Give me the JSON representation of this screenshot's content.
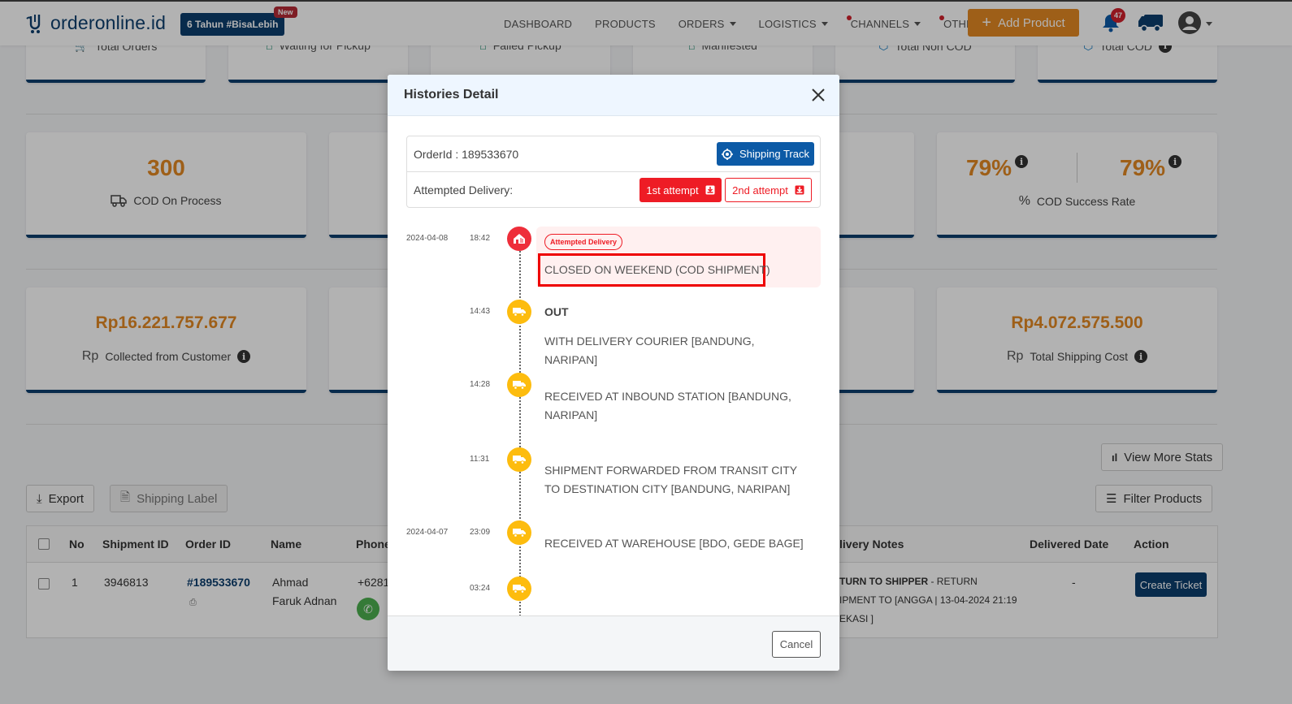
{
  "brand": {
    "name": "orderonline.id",
    "anniversary": "6 Tahun #BisaLebih",
    "new_badge": "New"
  },
  "nav": {
    "items": [
      {
        "label": "DASHBOARD",
        "dropdown": false,
        "dot": false
      },
      {
        "label": "PRODUCTS",
        "dropdown": false,
        "dot": false
      },
      {
        "label": "ORDERS",
        "dropdown": true,
        "dot": false
      },
      {
        "label": "LOGISTICS",
        "dropdown": true,
        "dot": false
      },
      {
        "label": "CHANNELS",
        "dropdown": true,
        "dot": true
      },
      {
        "label": "OTHERS",
        "dropdown": true,
        "dot": true
      }
    ],
    "add_product": "Add Product",
    "notification_count": "47"
  },
  "top_cards": [
    {
      "label": "Total Orders",
      "icon": "cart-icon"
    },
    {
      "label": "Waiting for Pickup",
      "icon": "warehouse-icon"
    },
    {
      "label": "Failed Pickup",
      "icon": "warehouse-icon"
    },
    {
      "label": "Manifested",
      "icon": "warehouse-icon"
    },
    {
      "label": "Total Non COD",
      "icon": "box-icon"
    },
    {
      "label": "Total COD",
      "icon": "box-icon"
    }
  ],
  "stats_row1": [
    {
      "value": "300",
      "label": "COD On Process",
      "icon": "truck-icon"
    },
    {
      "value": "",
      "label": ""
    },
    {
      "value": "",
      "label": ""
    },
    {
      "value_a": "79%",
      "value_b": "79%",
      "label": "COD Success Rate",
      "icon": "percent-icon"
    }
  ],
  "stats_row2": [
    {
      "value": "Rp16.221.757.677",
      "label": "Collected from Customer",
      "prefix": "Rp"
    },
    {
      "value": "",
      "label": ""
    },
    {
      "value": "",
      "label": ""
    },
    {
      "value": "Rp4.072.575.500",
      "label": "Total Shipping Cost",
      "prefix": "Rp"
    }
  ],
  "toolbar": {
    "view_more_stats": "View More Stats",
    "export": "Export",
    "shipping_label": "Shipping Label",
    "filter_products": "Filter Products"
  },
  "table": {
    "headers": [
      "No",
      "Shipment ID",
      "Order ID",
      "Name",
      "Phone",
      "livery Notes",
      "Delivered Date",
      "Action"
    ],
    "rows": [
      {
        "no": "1",
        "shipment_id": "3946813",
        "order_id": "#189533670",
        "name_line1": "Ahmad",
        "name_line2": "Faruk Adnan",
        "phone": "+6281",
        "notes_bold": "TURN TO SHIPPER",
        "notes_line1": " - RETURN",
        "notes_line2": "IPMENT TO [ANGGA | 13-04-2024 21:19",
        "notes_line3": "EKASI ]",
        "delivered_date": "-",
        "action": "Create Ticket"
      }
    ]
  },
  "modal": {
    "title": "Histories Detail",
    "order_id_label": "OrderId : 189533670",
    "shipping_track": "Shipping Track",
    "attempted_label": "Attempted Delivery:",
    "attempt1": "1st attempt",
    "attempt2": "2nd attempt",
    "timeline": [
      {
        "date": "2024-04-08",
        "time": "18:42",
        "status": "attempt",
        "tag": "Attempted Delivery",
        "title": "",
        "text": "CLOSED ON WEEKEND (COD SHIPMENT)"
      },
      {
        "date": "",
        "time": "14:43",
        "status": "transit",
        "title": "OUT",
        "text": "WITH DELIVERY COURIER [BANDUNG, NARIPAN]"
      },
      {
        "date": "",
        "time": "14:28",
        "status": "transit",
        "title": "",
        "text": "RECEIVED AT INBOUND STATION [BANDUNG, NARIPAN]"
      },
      {
        "date": "",
        "time": "11:31",
        "status": "transit",
        "title": "",
        "text": "SHIPMENT FORWARDED FROM TRANSIT CITY TO DESTINATION CITY [BANDUNG, NARIPAN]"
      },
      {
        "date": "2024-04-07",
        "time": "23:09",
        "status": "transit",
        "title": "",
        "text": "RECEIVED AT WAREHOUSE [BDO, GEDE BAGE]"
      },
      {
        "date": "",
        "time": "03:24",
        "status": "transit",
        "title": "",
        "text": ""
      }
    ],
    "cancel": "Cancel"
  },
  "colors": {
    "brand": "#0c3e6e",
    "accent": "#e28823",
    "danger": "#ee1c25",
    "transit": "#fdbc0e"
  }
}
